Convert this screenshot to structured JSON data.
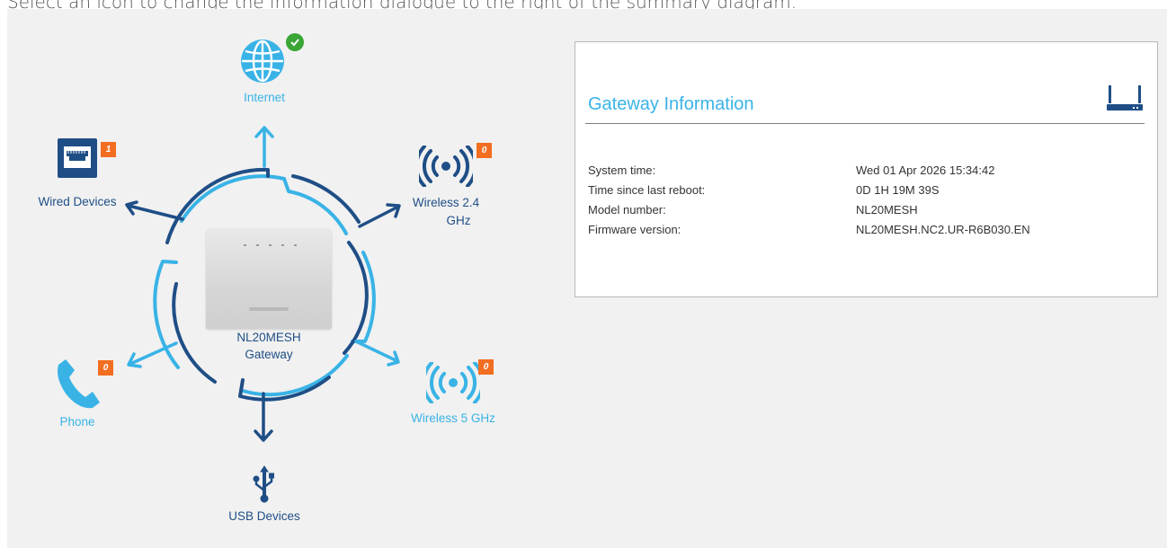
{
  "intro_text": "Select an icon to change the information dialogue to the right of the summary diagram.",
  "colors": {
    "dark_blue": "#1f4e86",
    "light_blue": "#39b3e6",
    "badge_orange": "#f26e21",
    "status_green": "#3aa635",
    "panel_background": "#f1f1f1"
  },
  "diagram": {
    "internet": {
      "label": "Internet",
      "icon": "globe-icon",
      "status": "connected-check"
    },
    "wired": {
      "label": "Wired Devices",
      "icon": "ethernet-port-icon",
      "count": "1"
    },
    "wireless24": {
      "label_line1": "Wireless 2.4",
      "label_line2": "GHz",
      "icon": "wireless-signal-icon",
      "count": "0"
    },
    "phone": {
      "label": "Phone",
      "icon": "phone-icon",
      "count": "0"
    },
    "wireless5": {
      "label": "Wireless 5 GHz",
      "icon": "wireless-signal-icon",
      "count": "0"
    },
    "usb": {
      "label": "USB Devices",
      "icon": "usb-icon"
    },
    "gateway": {
      "name": "NL20MESH",
      "role": "Gateway",
      "icon": "router-image"
    }
  },
  "info": {
    "title": "Gateway Information",
    "icon": "router-icon",
    "rows": [
      {
        "label": "System time:",
        "value": "Wed 01 Apr 2026 15:34:42"
      },
      {
        "label": "Time since last reboot:",
        "value": "0D 1H 19M 39S"
      },
      {
        "label": "Model number:",
        "value": "NL20MESH"
      },
      {
        "label": "Firmware version:",
        "value": "NL20MESH.NC2.UR-R6B030.EN"
      }
    ]
  }
}
